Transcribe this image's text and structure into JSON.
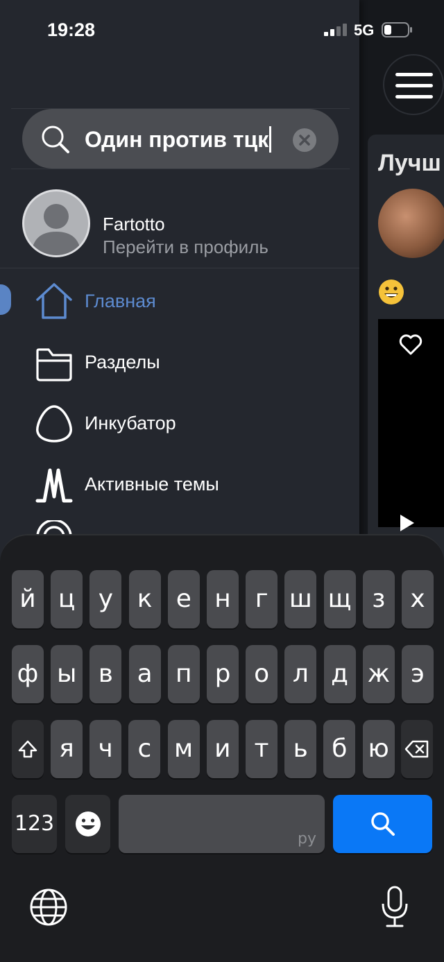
{
  "status_bar": {
    "time": "19:28",
    "network": "5G",
    "signal_icon": "cellular-signal-icon",
    "battery_icon": "battery-icon"
  },
  "search": {
    "query": "Один против тцк",
    "clear_icon": "clear-icon"
  },
  "profile": {
    "name": "Fartotto",
    "link": "Перейти в профиль"
  },
  "nav": {
    "items": [
      {
        "label": "Главная",
        "icon": "home-icon",
        "active": true
      },
      {
        "label": "Разделы",
        "icon": "folder-icon",
        "active": false
      },
      {
        "label": "Инкубатор",
        "icon": "egg-icon",
        "active": false
      },
      {
        "label": "Активные темы",
        "icon": "activity-icon",
        "active": false
      }
    ]
  },
  "right_panel": {
    "title": "Лучш",
    "menu_icon": "hamburger-menu-icon"
  },
  "keyboard": {
    "row1": [
      "й",
      "ц",
      "у",
      "к",
      "е",
      "н",
      "г",
      "ш",
      "щ",
      "з",
      "х"
    ],
    "row2": [
      "ф",
      "ы",
      "в",
      "а",
      "п",
      "р",
      "о",
      "л",
      "д",
      "ж",
      "э"
    ],
    "row3": [
      "я",
      "ч",
      "с",
      "м",
      "и",
      "т",
      "ь",
      "б",
      "ю"
    ],
    "numbers_label": "123",
    "space_lang": "ру",
    "search_key_icon": "search-icon"
  },
  "colors": {
    "accent": "#5d8bd0",
    "keyboard_blue": "#0a78f6",
    "drawer_bg": "#24272e"
  }
}
